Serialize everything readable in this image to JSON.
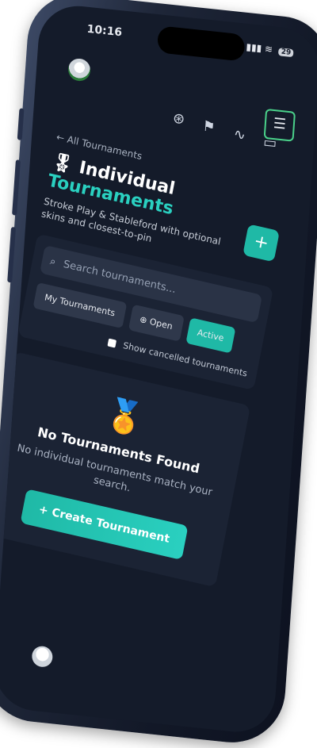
{
  "status": {
    "time": "10:16",
    "battery": "29"
  },
  "nav": {
    "icons": [
      "gamepad-icon",
      "flag-icon",
      "activity-icon",
      "chat-icon"
    ],
    "menu_glyph": "☰"
  },
  "header": {
    "back_label": "← All Tournaments",
    "title_main": "Individual",
    "title_accent": "Tournaments",
    "subtitle": "Stroke Play & Stableford with optional skins and closest-to-pin",
    "add_glyph": "+"
  },
  "filters": {
    "search_placeholder": "Search tournaments...",
    "tabs": [
      "My Tournaments",
      "Open",
      "Active"
    ],
    "show_cancelled": "Show cancelled tournaments"
  },
  "empty": {
    "title": "No Tournaments Found",
    "desc": "No individual tournaments match your search.",
    "cta": "+ Create Tournament"
  },
  "colors": {
    "accent": "#2ad0c0",
    "button": "#1fb9a6",
    "menu_border": "#4ad18a"
  }
}
